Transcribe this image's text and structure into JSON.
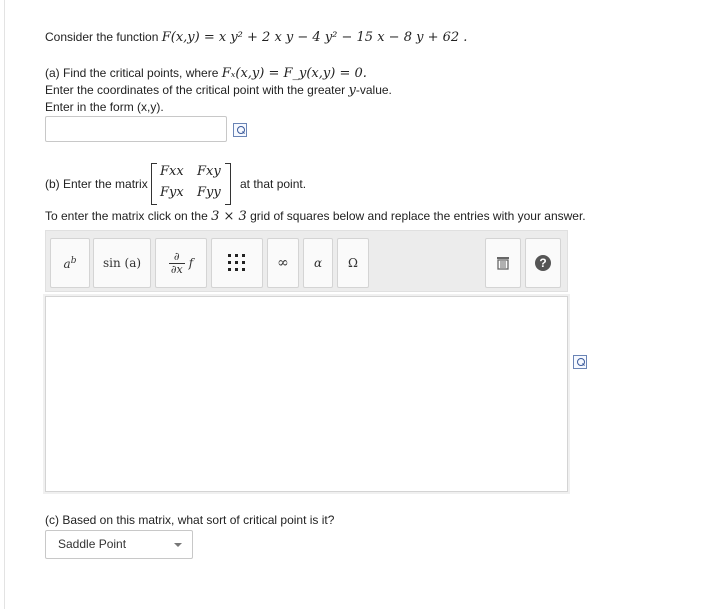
{
  "problem": {
    "intro": "Consider the function ",
    "function": "F(x,y) = x y² + 2 x y − 4 y² − 15 x − 8 y + 62 ."
  },
  "part_a": {
    "line1_prefix": "(a) Find the critical points, where ",
    "line1_math": "Fₓ(x,y) = F_y(x,y) = 0.",
    "line2_prefix": "Enter the coordinates of the critical point with the greater ",
    "line2_var": "y",
    "line2_suffix": "-value.",
    "line3": "Enter in the form (x,y).",
    "answer_value": ""
  },
  "part_b": {
    "label_left": "(b) Enter the matrix",
    "label_right": "at that point.",
    "matrix": [
      "Fxx",
      "Fxy",
      "Fyx",
      "Fyy"
    ],
    "instruction_prefix": "To enter the matrix click on the ",
    "instruction_math": "3 × 3",
    "instruction_suffix": " grid of squares below and replace the entries with your answer."
  },
  "toolbar": {
    "superscript": "a",
    "superscript_exp": "b",
    "sin": "sin (a)",
    "partial_top": "∂",
    "partial_bottom": "∂x",
    "partial_f": "f",
    "matrix_grid": "⋮⋮⋮",
    "infinity": "∞",
    "alpha": "α",
    "omega": "Ω",
    "help": "?"
  },
  "part_c": {
    "question": "(c) Based on this matrix, what sort of critical point is it?",
    "selected": "Saddle Point"
  },
  "colors": {
    "accent": "#6a84b5",
    "toolbar_bg": "#ececec",
    "help_bg": "#555555"
  }
}
